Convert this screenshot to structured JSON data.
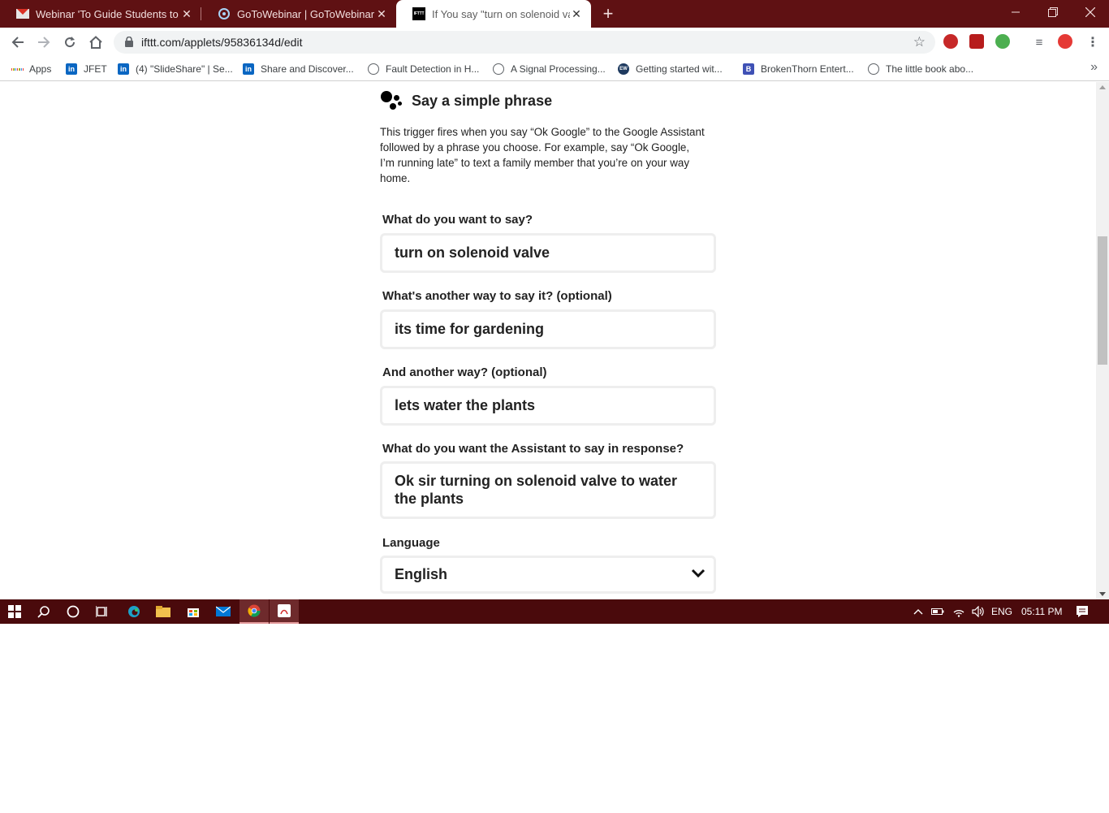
{
  "browser": {
    "tabs": [
      {
        "title": "Webinar 'To Guide Students to Se",
        "favicon": "gmail-icon",
        "active": false
      },
      {
        "title": "GoToWebinar | GoToWebinar",
        "favicon": "gotowebinar-icon",
        "active": false
      },
      {
        "title": "If You say \"turn on solenoid valve",
        "favicon": "ifttt-icon",
        "active": true
      }
    ],
    "favicon_text": "IFTTT",
    "url": "ifttt.com/applets/95836134d/edit",
    "bookmarks": [
      {
        "label": "Apps",
        "icon": "apps-grid-icon"
      },
      {
        "label": "JFET",
        "icon": "linkedin-icon"
      },
      {
        "label": "(4) \"SlideShare\" | Se...",
        "icon": "linkedin-icon"
      },
      {
        "label": "Share and Discover...",
        "icon": "linkedin-icon"
      },
      {
        "label": "Fault Detection in H...",
        "icon": "globe-icon"
      },
      {
        "label": "A Signal Processing...",
        "icon": "globe-icon"
      },
      {
        "label": "Getting started wit...",
        "icon": "ew-icon"
      },
      {
        "label": "BrokenThorn Entert...",
        "icon": "bt-icon"
      },
      {
        "label": "The little book abo...",
        "icon": "globe-icon"
      }
    ],
    "bookmark_badges": {
      "linkedin": "in",
      "ew": "EW",
      "bt": "B"
    }
  },
  "trigger": {
    "title": "Say a simple phrase",
    "description": "This trigger fires when you say “Ok Google” to the Google Assistant followed by a phrase you choose. For example, say “Ok Google, I’m running late” to text a family member that you’re on your way home."
  },
  "form": {
    "fields": [
      {
        "label": "What do you want to say?",
        "value": "turn on solenoid valve"
      },
      {
        "label": "What's another way to say it? (optional)",
        "value": "its time for gardening"
      },
      {
        "label": "And another way? (optional)",
        "value": "lets water the plants"
      },
      {
        "label": "What do you want the Assistant to say in response?",
        "value": "Ok sir turning on solenoid valve  to water the plants"
      }
    ],
    "language_label": "Language",
    "language_value": "English"
  },
  "taskbar": {
    "lang": "ENG",
    "time": "05:11 PM"
  },
  "colors": {
    "tabstrip": "#5f1113",
    "taskbar": "#4a0a0c",
    "field_border": "#eeeeee"
  }
}
